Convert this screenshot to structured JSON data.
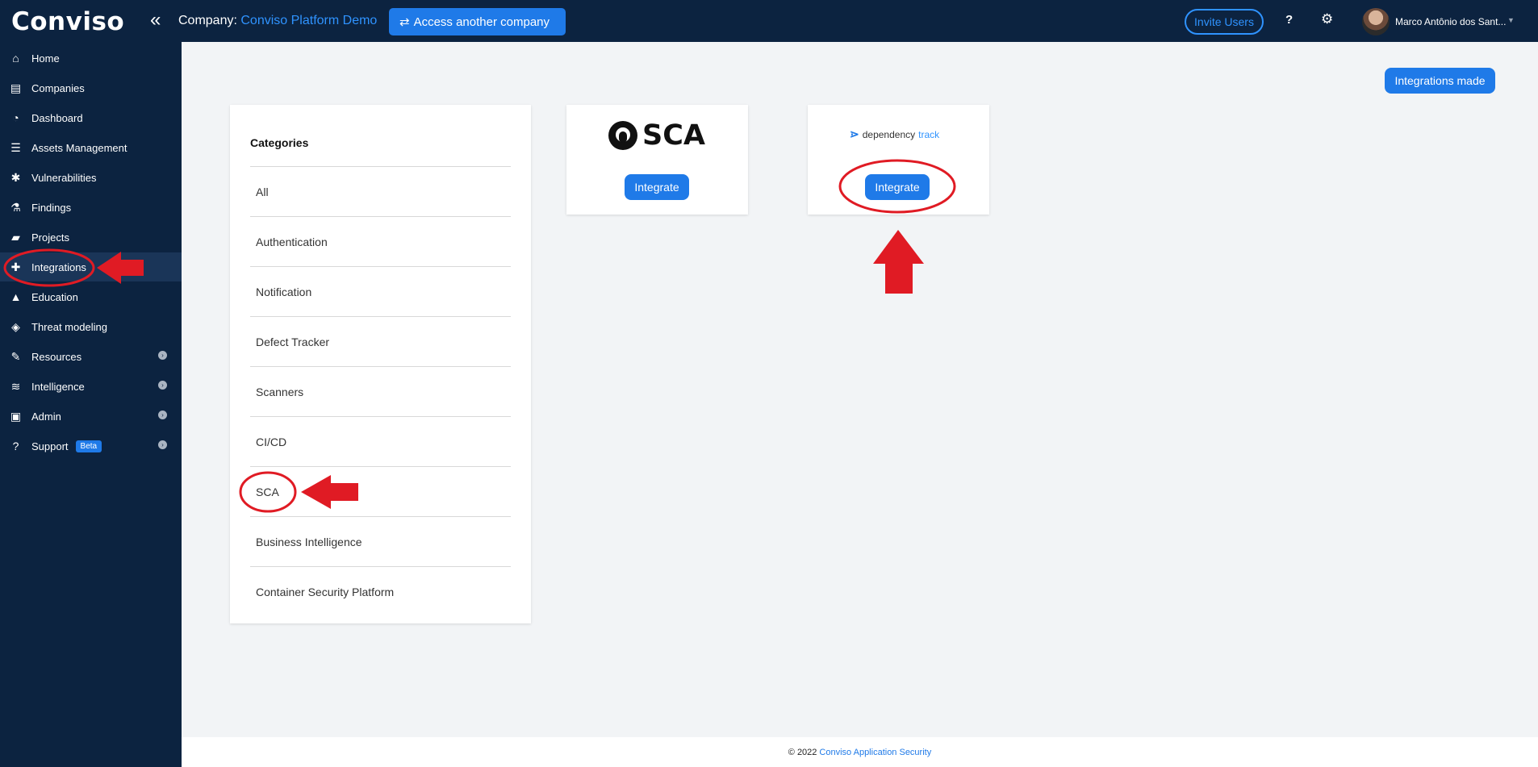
{
  "header": {
    "logo": "Conviso",
    "collapse_icon": "double-chevron-left-icon",
    "company_label": "Company:",
    "company_name": "Conviso Platform Demo",
    "access_button": "Access another company",
    "invite_button": "Invite Users",
    "help_label": "?",
    "user_name": "Marco Antônio dos Sant..."
  },
  "sidebar": {
    "items": [
      {
        "label": "Home",
        "icon": "home-icon"
      },
      {
        "label": "Companies",
        "icon": "building-icon"
      },
      {
        "label": "Dashboard",
        "icon": "gauge-icon"
      },
      {
        "label": "Assets Management",
        "icon": "server-icon"
      },
      {
        "label": "Vulnerabilities",
        "icon": "bug-icon"
      },
      {
        "label": "Findings",
        "icon": "flask-icon"
      },
      {
        "label": "Projects",
        "icon": "folder-icon"
      },
      {
        "label": "Integrations",
        "icon": "puzzle-icon"
      },
      {
        "label": "Education",
        "icon": "graduation-cap-icon"
      },
      {
        "label": "Threat modeling",
        "icon": "shield-icon"
      },
      {
        "label": "Resources",
        "icon": "wrench-icon"
      },
      {
        "label": "Intelligence",
        "icon": "database-icon"
      },
      {
        "label": "Admin",
        "icon": "briefcase-icon"
      },
      {
        "label": "Support",
        "icon": "question-circle-icon"
      }
    ],
    "support_badge": "Beta"
  },
  "main": {
    "integrations_made_button": "Integrations made",
    "categories_title": "Categories",
    "categories": [
      "All",
      "Authentication",
      "Notification",
      "Defect Tracker",
      "Scanners",
      "CI/CD",
      "SCA",
      "Business Intelligence",
      "Container Security Platform"
    ],
    "cards": [
      {
        "logo_text": "SCA",
        "button": "Integrate"
      },
      {
        "logo_text_main": "dependency",
        "logo_text_accent": "track",
        "button": "Integrate"
      }
    ]
  },
  "footer": {
    "copyright": "© 2022",
    "link": "Conviso Application Security"
  },
  "colors": {
    "navy": "#0c2340",
    "primary_blue": "#1f7ae8",
    "accent_blue": "#2f93ff",
    "annotation_red": "#e01b24"
  }
}
